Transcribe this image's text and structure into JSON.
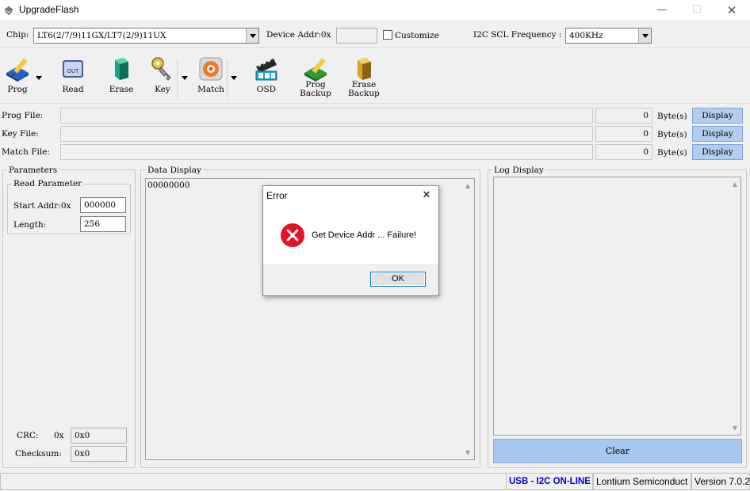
{
  "window": {
    "title": "UpgradeFlash",
    "controls": [
      "—",
      "☐",
      "✕"
    ]
  },
  "config": {
    "chip_label": "Chip:",
    "chip_value": "LT6(2/7/9)11GX/LT7(2/9)11UX",
    "device_addr_label": "Device Addr:0x",
    "device_addr_value": "",
    "customize_label": "Customize",
    "customize_checked": false,
    "i2c_label": "I2C SCL Frequency :",
    "i2c_value": "400KHz"
  },
  "toolbar": {
    "prog": "Prog",
    "read": "Read",
    "erase": "Erase",
    "key": "Key",
    "match": "Match",
    "osd": "OSD",
    "prog_backup": "Prog\nBackup",
    "erase_backup": "Erase\nBackup",
    "read_icon_text": "OUT"
  },
  "files": [
    {
      "label": "Prog File:",
      "path": "",
      "size": "0",
      "unit": "Byte(s)",
      "button": "Display"
    },
    {
      "label": "Key  File:",
      "path": "",
      "size": "0",
      "unit": "Byte(s)",
      "button": "Display"
    },
    {
      "label": "Match File:",
      "path": "",
      "size": "0",
      "unit": "Byte(s)",
      "button": "Display"
    }
  ],
  "parameters": {
    "title": "Parameters",
    "read_title": "Read Parameter",
    "start_addr_label": "Start Addr:0x",
    "start_addr_value": "000000",
    "length_label": "Length:",
    "length_value": "256",
    "crc_label": "CRC:",
    "crc_prefix": "0x",
    "crc_value": "0x0",
    "checksum_label": "Checksum:",
    "checksum_value": "0x0"
  },
  "data_display": {
    "title": "Data Display",
    "content": "00000000"
  },
  "log_display": {
    "title": "Log Display",
    "content": "",
    "clear_label": "Clear"
  },
  "status_bar": {
    "empty": "",
    "connection": "USB - I2C ON-LINE",
    "vendor": "Lontium Semiconduct",
    "version": "Version 7.0.2"
  },
  "dialog": {
    "title": "Error",
    "message": "Get Device Addr ... Failure!",
    "ok_label": "OK",
    "close": "✕"
  },
  "colors": {
    "accent_button": "#b3cdee",
    "clear_button": "#a9c6ef",
    "error_red": "#e81123",
    "status_online": "#0000cc"
  }
}
